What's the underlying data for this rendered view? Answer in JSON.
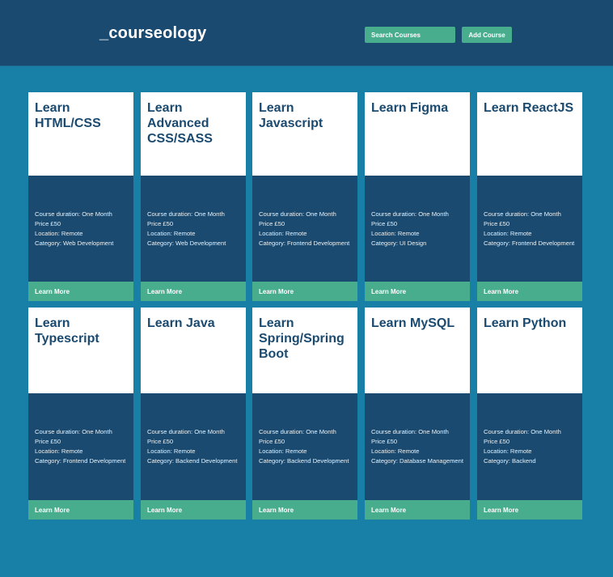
{
  "header": {
    "logo": "_courseology",
    "search_placeholder": "Search Courses",
    "add_label": "Add Course"
  },
  "courses": [
    {
      "title": "Learn HTML/CSS",
      "duration": "Course duration: One Month",
      "price": "Price £50",
      "location": "Location: Remote",
      "category": "Category: Web Development",
      "button": "Learn More"
    },
    {
      "title": "Learn Advanced CSS/SASS",
      "duration": "Course duration: One Month",
      "price": "Price £50",
      "location": "Location: Remote",
      "category": "Category: Web Development",
      "button": "Learn More"
    },
    {
      "title": "Learn Javascript",
      "duration": "Course duration: One Month",
      "price": "Price £50",
      "location": "Location: Remote",
      "category": "Category: Frontend Development",
      "button": "Learn More"
    },
    {
      "title": "Learn Figma",
      "duration": "Course duration: One Month",
      "price": "Price £50",
      "location": "Location: Remote",
      "category": "Category: UI Design",
      "button": "Learn More"
    },
    {
      "title": "Learn ReactJS",
      "duration": "Course duration: One Month",
      "price": "Price £50",
      "location": "Location: Remote",
      "category": "Category: Frontend Development",
      "button": "Learn More"
    },
    {
      "title": "Learn Typescript",
      "duration": "Course duration: One Month",
      "price": "Price £50",
      "location": "Location: Remote",
      "category": "Category: Frontend Development",
      "button": "Learn More"
    },
    {
      "title": "Learn Java",
      "duration": "Course duration: One Month",
      "price": "Price £50",
      "location": "Location: Remote",
      "category": "Category: Backend Development",
      "button": "Learn More"
    },
    {
      "title": "Learn Spring/Spring Boot",
      "duration": "Course duration: One Month",
      "price": "Price £50",
      "location": "Location: Remote",
      "category": "Category: Backend Development",
      "button": "Learn More"
    },
    {
      "title": "Learn MySQL",
      "duration": "Course duration: One Month",
      "price": "Price £50",
      "location": "Location: Remote",
      "category": "Category: Database Management",
      "button": "Learn More"
    },
    {
      "title": "Learn Python",
      "duration": "Course duration: One Month",
      "price": "Price £50",
      "location": "Location: Remote",
      "category": "Category: Backend",
      "button": "Learn More"
    }
  ],
  "colors": {
    "page_background": "#187fa6",
    "header_background": "#1a4a70",
    "accent_green": "#48ad8c",
    "card_text": "#1a4a70"
  }
}
